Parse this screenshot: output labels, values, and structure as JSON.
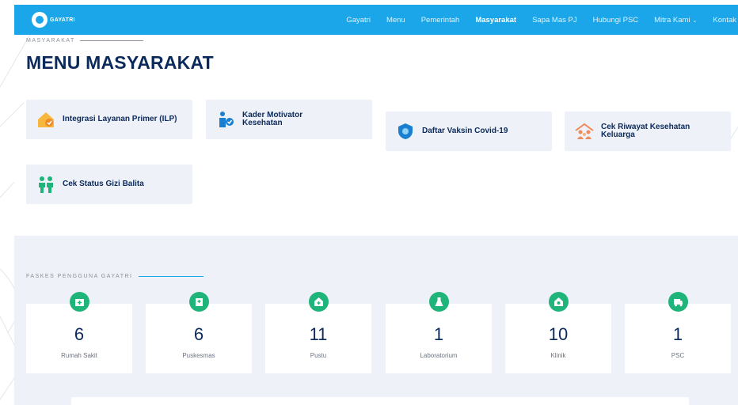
{
  "navbar": {
    "logo_text": "GAYATRI",
    "items": [
      {
        "label": "Gayatri",
        "active": false
      },
      {
        "label": "Menu",
        "active": false
      },
      {
        "label": "Pemerintah",
        "active": false
      },
      {
        "label": "Masyarakat",
        "active": true
      },
      {
        "label": "Sapa Mas PJ",
        "active": false
      },
      {
        "label": "Hubungi PSC",
        "active": false
      },
      {
        "label": "Mitra Kami",
        "active": false,
        "dropdown": true
      },
      {
        "label": "Kontak",
        "active": false
      }
    ],
    "caret": "⌄"
  },
  "section": {
    "label": "MASYARAKAT",
    "title": "MENU MASYARAKAT"
  },
  "menu": [
    {
      "label": "Integrasi Layanan Primer (ILP)",
      "icon": "house-icon"
    },
    {
      "label": "Kader Motivator Kesehatan",
      "icon": "person-check-icon"
    },
    {
      "label": "Daftar Vaksin Covid-19",
      "icon": "shield-icon"
    },
    {
      "label": "Cek Riwayat Kesehatan Keluarga",
      "icon": "family-home-icon"
    },
    {
      "label": "Cek Status Gizi Balita",
      "icon": "children-icon"
    }
  ],
  "faskes": {
    "label": "FASKES PENGGUNA GAYATRI",
    "stats": [
      {
        "value": "6",
        "label": "Rumah Sakit",
        "icon": "hospital-icon"
      },
      {
        "value": "6",
        "label": "Puskesmas",
        "icon": "clinic-building-icon"
      },
      {
        "value": "11",
        "label": "Pustu",
        "icon": "medical-house-icon"
      },
      {
        "value": "1",
        "label": "Laboratorium",
        "icon": "flask-icon"
      },
      {
        "value": "10",
        "label": "Klinik",
        "icon": "clinic-house-icon"
      },
      {
        "value": "1",
        "label": "PSC",
        "icon": "ambulance-icon"
      }
    ]
  },
  "colors": {
    "primary": "#1aa6e8",
    "title": "#0b2a5b",
    "card_bg": "#eef1f8",
    "badge": "#1fb57a"
  }
}
